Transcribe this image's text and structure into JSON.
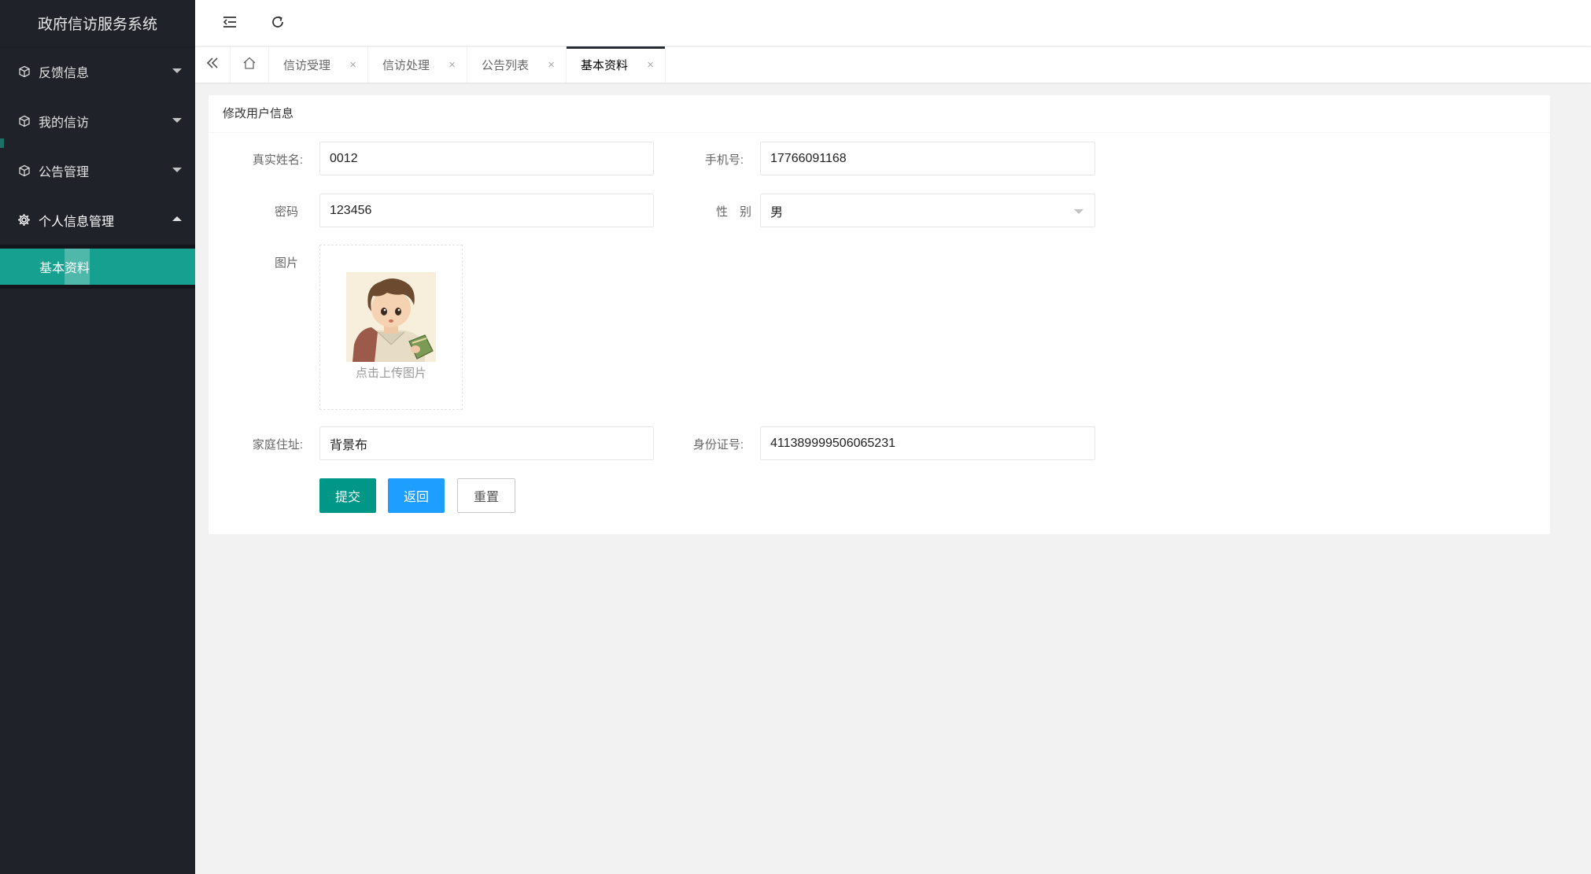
{
  "app": {
    "title": "政府信访服务系统"
  },
  "sidebar": {
    "items": [
      {
        "label": "反馈信息",
        "icon": "cube-icon"
      },
      {
        "label": "我的信访",
        "icon": "cube-icon"
      },
      {
        "label": "公告管理",
        "icon": "cube-icon"
      },
      {
        "label": "个人信息管理",
        "icon": "gear-icon"
      }
    ],
    "subitems": [
      {
        "label": "基本资料"
      }
    ]
  },
  "header": {
    "menu_icon": "menu-fold-icon",
    "refresh_icon": "refresh-icon"
  },
  "tabs": [
    {
      "label": "信访受理"
    },
    {
      "label": "信访处理"
    },
    {
      "label": "公告列表"
    },
    {
      "label": "基本资料"
    }
  ],
  "tab_close": "×",
  "form": {
    "title": "修改用户信息",
    "real_name_label": "真实姓名:",
    "real_name": "0012",
    "phone_label": "手机号:",
    "phone": "17766091168",
    "password_label": "密码",
    "password": "123456",
    "gender_label": "性　别",
    "gender": "男",
    "image_label": "图片",
    "upload_text": "点击上传图片",
    "address_label": "家庭住址:",
    "address": "背景布",
    "id_label": "身份证号:",
    "id_number": "411389999506065231",
    "submit": "提交",
    "back": "返回",
    "reset": "重置"
  },
  "colors": {
    "sidebar": "#20222a",
    "accent": "#16a08f",
    "primary": "#009688",
    "info": "#1e9fff"
  }
}
